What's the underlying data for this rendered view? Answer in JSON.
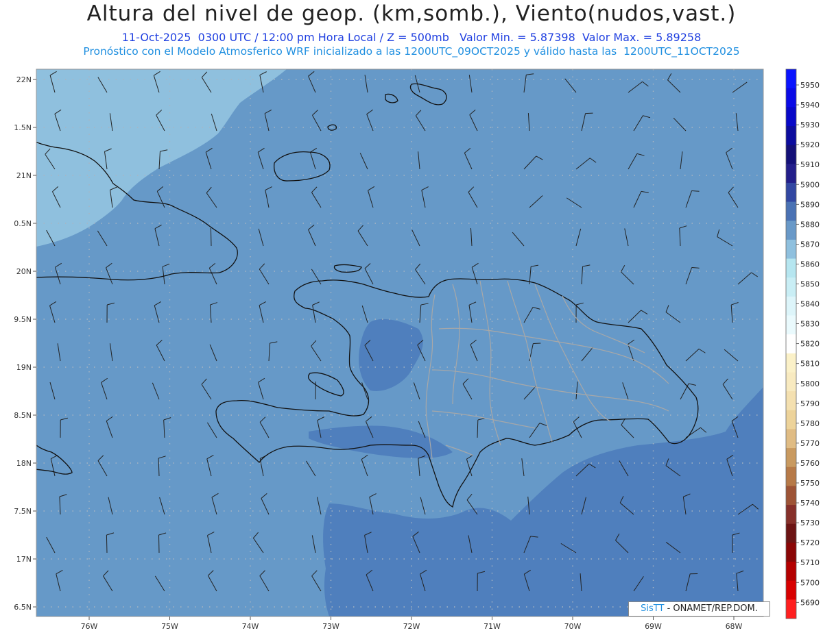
{
  "header": {
    "title": "Altura del nivel de geop. (km,somb.), Viento(nudos,vast.)",
    "subtitle": "11-Oct-2025  0300 UTC / 12:00 pm Hora Local / Z = 500mb   Valor Min. = 5.87398  Valor Max. = 5.89258",
    "model_line": "Pronóstico con el Modelo Atmosferico WRF inicializado a las 1200UTC_09OCT2025 y válido hasta las  1200UTC_11OCT2025"
  },
  "axes": {
    "lat_labels": [
      "22N",
      "1.5N",
      "21N",
      "0.5N",
      "20N",
      "9.5N",
      "19N",
      "8.5N",
      "18N",
      "7.5N",
      "17N",
      "6.5N"
    ],
    "lon_labels": [
      "76W",
      "75W",
      "74W",
      "73W",
      "72W",
      "71W",
      "70W",
      "69W",
      "68W"
    ]
  },
  "colorbar": {
    "labels": [
      "5950",
      "5940",
      "5930",
      "5920",
      "5910",
      "5900",
      "5890",
      "5880",
      "5870",
      "5860",
      "5850",
      "5840",
      "5830",
      "5820",
      "5810",
      "5800",
      "5790",
      "5780",
      "5770",
      "5760",
      "5750",
      "5740",
      "5730",
      "5720",
      "5710",
      "5700",
      "5690"
    ],
    "colors": [
      "#0a14ff",
      "#0a0ae6",
      "#0808c8",
      "#0c0c9e",
      "#141078",
      "#231e8a",
      "#3247a2",
      "#4a72b4",
      "#6999c8",
      "#8fc0de",
      "#b6e6f0",
      "#c9eef5",
      "#ddf5fa",
      "#eafafd",
      "#ffffff",
      "#fbf1c8",
      "#f8eac0",
      "#f4e0b0",
      "#edd39a",
      "#e0bc84",
      "#c99a60",
      "#b77a48",
      "#9e5436",
      "#86302a",
      "#6c1414",
      "#8a0606",
      "#b40000",
      "#d80000",
      "#ff1f1f"
    ]
  },
  "map": {
    "colors": {
      "light_region": "#8fc0de",
      "mid_region": "#6699c8",
      "dark_region": "#4f7fbd",
      "coast": "#111111",
      "borders": "#a8a8a8",
      "grid": "#a9b5c2"
    }
  },
  "credit": {
    "brand": "SisTT",
    "text": " - ONAMET/REP.DOM."
  }
}
